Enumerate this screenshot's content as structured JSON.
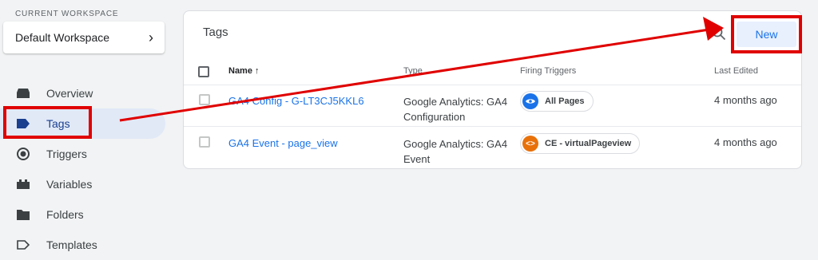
{
  "workspace": {
    "section_label": "CURRENT WORKSPACE",
    "name": "Default Workspace"
  },
  "nav": {
    "items": [
      {
        "label": "Overview",
        "icon": "overview-icon"
      },
      {
        "label": "Tags",
        "icon": "tag-icon",
        "active": true
      },
      {
        "label": "Triggers",
        "icon": "trigger-icon"
      },
      {
        "label": "Variables",
        "icon": "variables-icon"
      },
      {
        "label": "Folders",
        "icon": "folder-icon"
      },
      {
        "label": "Templates",
        "icon": "template-icon"
      }
    ]
  },
  "tags_panel": {
    "title": "Tags",
    "new_label": "New",
    "columns": {
      "name": "Name",
      "sort_indicator": "↑",
      "type": "Type",
      "firing_triggers": "Firing Triggers",
      "last_edited": "Last Edited"
    },
    "rows": [
      {
        "name": "GA4 Config - G-LT3CJ5KKL6",
        "type_line1": "Google Analytics: GA4",
        "type_line2": "Configuration",
        "trigger": "All Pages",
        "trigger_icon": "eye-icon",
        "trigger_color": "#1a73e8",
        "last_edited": "4 months ago"
      },
      {
        "name": "GA4 Event - page_view",
        "type_line1": "Google Analytics: GA4",
        "type_line2": "Event",
        "trigger": "CE - virtualPageview",
        "trigger_icon": "code-icon",
        "trigger_color": "#e8710a",
        "last_edited": "4 months ago"
      }
    ]
  },
  "colors": {
    "accent": "#1a73e8",
    "highlight": "#e00000"
  }
}
